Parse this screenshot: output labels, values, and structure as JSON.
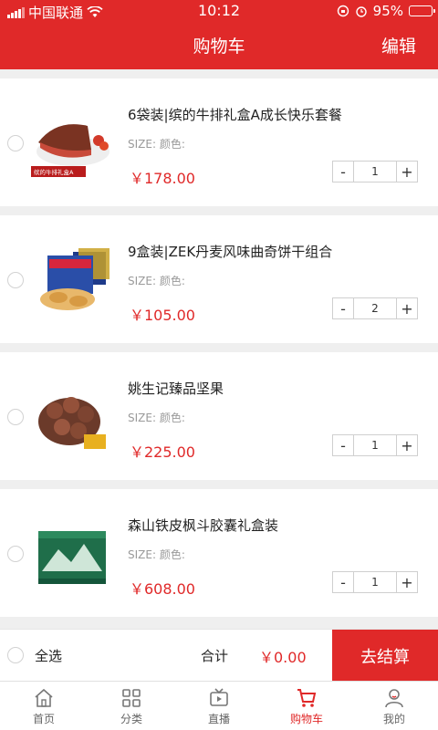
{
  "status": {
    "carrier": "中国联通",
    "time": "10:12",
    "battery": "95%"
  },
  "header": {
    "title": "购物车",
    "edit": "编辑"
  },
  "items": [
    {
      "name": "6袋装|缤的牛排礼盒A成长快乐套餐",
      "spec": "SIZE:  颜色:",
      "price": "￥178.00",
      "qty": "1",
      "image_text": "缤的牛排礼盒A"
    },
    {
      "name": "9盒装|ZEK丹麦风味曲奇饼干组合",
      "spec": "SIZE:  颜色:",
      "price": "￥105.00",
      "qty": "2"
    },
    {
      "name": "姚生记臻品坚果",
      "spec": "SIZE:  颜色:",
      "price": "￥225.00",
      "qty": "1"
    },
    {
      "name": "森山铁皮枫斗胶囊礼盒装",
      "spec": "SIZE:  颜色:",
      "price": "￥608.00",
      "qty": "1"
    }
  ],
  "footer": {
    "select_all": "全选",
    "total_label": "合计",
    "total": "￥0.00",
    "checkout": "去结算"
  },
  "tabs": [
    {
      "label": "首页",
      "icon": "home-icon"
    },
    {
      "label": "分类",
      "icon": "grid-icon"
    },
    {
      "label": "直播",
      "icon": "tv-icon"
    },
    {
      "label": "购物车",
      "icon": "cart-icon"
    },
    {
      "label": "我的",
      "icon": "user-icon"
    }
  ],
  "colors": {
    "accent": "#e02929"
  }
}
